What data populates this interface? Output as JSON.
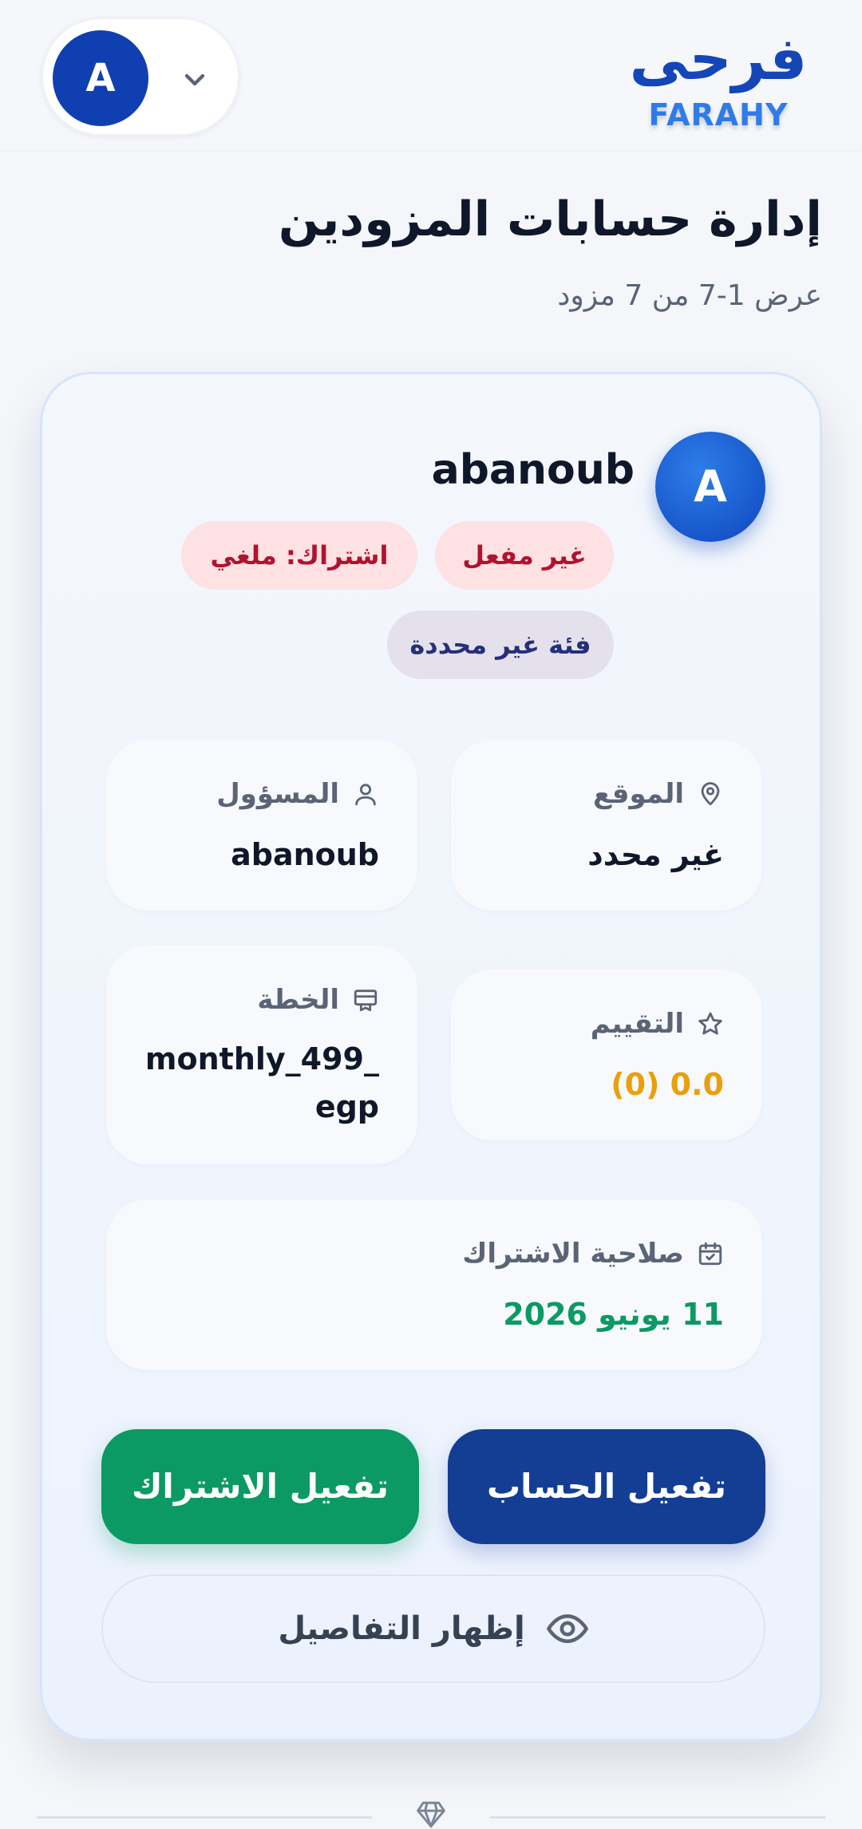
{
  "header": {
    "brand_ar": "فرحى",
    "brand_en": "FARAHY",
    "user_initial": "A"
  },
  "page": {
    "title": "إدارة حسابات المزودين",
    "subtitle": "عرض 1-7 من 7 مزود"
  },
  "provider": {
    "initial": "A",
    "name": "abanoub",
    "badges": {
      "status": "غير مفعل",
      "subscription": "اشتراك: ملغي",
      "category": "فئة غير محددة"
    },
    "location": {
      "label": "الموقع",
      "value": "غير محدد"
    },
    "owner": {
      "label": "المسؤول",
      "value": "abanoub"
    },
    "rating": {
      "label": "التقييم",
      "value": "0.0 (0)"
    },
    "plan": {
      "label": "الخطة",
      "value_line1": "monthly_499_",
      "value_line2": "egp"
    },
    "expiry": {
      "label": "صلاحية الاشتراك",
      "value": "11 يونيو 2026"
    },
    "actions": {
      "activate_account": "تفعيل الحساب",
      "activate_subscription": "تفعيل الاشتراك",
      "show_details": "إظهار التفاصيل"
    }
  },
  "colors": {
    "brand": "#1446b8",
    "primary_button": "#143d94",
    "success_button": "#0b9a63",
    "rating_value": "#e9a00b",
    "expiry_value": "#0b9a63",
    "danger_badge_text": "#b0132e"
  }
}
